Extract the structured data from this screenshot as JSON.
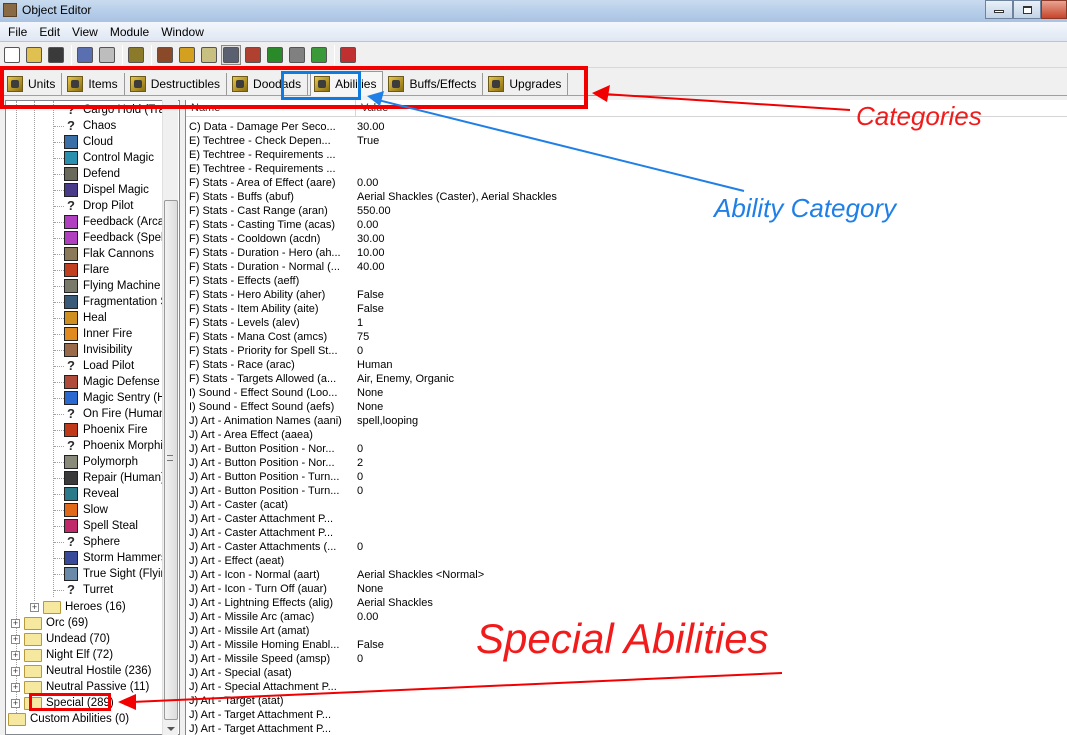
{
  "window": {
    "title": "Object Editor",
    "controls": [
      "minimize",
      "maximize",
      "close"
    ]
  },
  "menu": [
    "File",
    "Edit",
    "View",
    "Module",
    "Window"
  ],
  "toolbar": [
    {
      "icon": "new-file-icon",
      "color": "#ffffff"
    },
    {
      "icon": "open-folder-icon",
      "color": "#e0c050"
    },
    {
      "icon": "save-disk-icon",
      "color": "#3a3a3a"
    },
    {
      "sep": true
    },
    {
      "icon": "copy-icon",
      "color": "#5a6fb0"
    },
    {
      "icon": "paste-disabled-icon",
      "color": "#bdbdbd"
    },
    {
      "sep": true
    },
    {
      "icon": "abilities-fist-icon",
      "color": "#8a7a2a"
    },
    {
      "sep": true
    },
    {
      "icon": "terrain-editor-icon",
      "color": "#8a4a2a"
    },
    {
      "icon": "trigger-editor-icon",
      "color": "#d4a020"
    },
    {
      "icon": "sound-editor-icon",
      "color": "#c8c080"
    },
    {
      "icon": "object-editor-icon",
      "color": "#5a6070",
      "pressed": true
    },
    {
      "icon": "campaign-editor-icon",
      "color": "#b04030"
    },
    {
      "icon": "ai-editor-icon",
      "color": "#2a8a2a"
    },
    {
      "icon": "import-manager-icon",
      "color": "#808080"
    },
    {
      "icon": "object-manager-icon",
      "color": "#3a9a3a"
    },
    {
      "sep": true
    },
    {
      "icon": "test-map-icon",
      "color": "#c03030"
    }
  ],
  "tabs": [
    {
      "label": "Units",
      "icon": "units-helmet-icon",
      "active": false
    },
    {
      "label": "Items",
      "icon": "items-chest-icon",
      "active": false
    },
    {
      "label": "Destructibles",
      "icon": "destructibles-tree-icon",
      "active": false
    },
    {
      "label": "Doodads",
      "icon": "doodads-tower-icon",
      "active": false
    },
    {
      "label": "Abilities",
      "icon": "abilities-fist-icon",
      "active": true
    },
    {
      "label": "Buffs/Effects",
      "icon": "buffs-fist-icon",
      "active": false
    },
    {
      "label": "Upgrades",
      "icon": "upgrades-shield-icon",
      "active": false
    }
  ],
  "tree": {
    "partial_top_item": "Cargo Hold (Tra",
    "abilities": [
      {
        "label": "Chaos",
        "icon": "unknown-ability-icon",
        "color": "#333"
      },
      {
        "label": "Cloud",
        "icon": "cloud-icon",
        "color": "#3a6fa8"
      },
      {
        "label": "Control Magic",
        "icon": "control-magic-icon",
        "color": "#2a90b0"
      },
      {
        "label": "Defend",
        "icon": "defend-icon",
        "color": "#6a6a5a"
      },
      {
        "label": "Dispel Magic",
        "icon": "dispel-magic-icon",
        "color": "#4a3a8a"
      },
      {
        "label": "Drop Pilot",
        "icon": "unknown-ability-icon",
        "color": "#333"
      },
      {
        "label": "Feedback (Arca",
        "icon": "feedback-icon",
        "color": "#b040c0"
      },
      {
        "label": "Feedback (Spell",
        "icon": "feedback-icon",
        "color": "#b040c0"
      },
      {
        "label": "Flak Cannons",
        "icon": "flak-cannons-icon",
        "color": "#8a7a5a"
      },
      {
        "label": "Flare",
        "icon": "flare-icon",
        "color": "#c04020"
      },
      {
        "label": "Flying Machine I",
        "icon": "flying-machine-icon",
        "color": "#7a7a6a"
      },
      {
        "label": "Fragmentation S",
        "icon": "fragmentation-icon",
        "color": "#3a5a7a"
      },
      {
        "label": "Heal",
        "icon": "heal-icon",
        "color": "#d09020"
      },
      {
        "label": "Inner Fire",
        "icon": "inner-fire-icon",
        "color": "#e08a20"
      },
      {
        "label": "Invisibility",
        "icon": "invisibility-icon",
        "color": "#9a6a4a"
      },
      {
        "label": "Load Pilot",
        "icon": "unknown-ability-icon",
        "color": "#333"
      },
      {
        "label": "Magic Defense",
        "icon": "magic-defense-icon",
        "color": "#b04a3a"
      },
      {
        "label": "Magic Sentry (H",
        "icon": "magic-sentry-icon",
        "color": "#2a6ad0"
      },
      {
        "label": "On Fire (Human)",
        "icon": "unknown-ability-icon",
        "color": "#333"
      },
      {
        "label": "Phoenix Fire",
        "icon": "phoenix-fire-icon",
        "color": "#c03a1a"
      },
      {
        "label": "Phoenix Morphir",
        "icon": "unknown-ability-icon",
        "color": "#333"
      },
      {
        "label": "Polymorph",
        "icon": "polymorph-icon",
        "color": "#8a8a7a"
      },
      {
        "label": "Repair (Human)",
        "icon": "repair-icon",
        "color": "#3a3a3a"
      },
      {
        "label": "Reveal",
        "icon": "reveal-icon",
        "color": "#2a7a8a"
      },
      {
        "label": "Slow",
        "icon": "slow-icon",
        "color": "#e06a1a"
      },
      {
        "label": "Spell Steal",
        "icon": "spell-steal-icon",
        "color": "#c02a6a"
      },
      {
        "label": "Sphere",
        "icon": "unknown-ability-icon",
        "color": "#333"
      },
      {
        "label": "Storm Hammers",
        "icon": "storm-hammers-icon",
        "color": "#3a4a9a"
      },
      {
        "label": "True Sight (Flyin",
        "icon": "true-sight-icon",
        "color": "#6a8aaa"
      },
      {
        "label": "Turret",
        "icon": "unknown-ability-icon",
        "color": "#333"
      }
    ],
    "subfolder": {
      "label": "Heroes (16)"
    },
    "race_folders": [
      {
        "label": "Orc (69)"
      },
      {
        "label": "Undead (70)"
      },
      {
        "label": "Night Elf (72)"
      },
      {
        "label": "Neutral Hostile (236)"
      },
      {
        "label": "Neutral Passive (11)"
      },
      {
        "label": "Special (289)"
      }
    ],
    "root_folder": {
      "label": "Custom Abilities (0)"
    }
  },
  "properties": {
    "columns": {
      "name": "Name",
      "value": "Value"
    },
    "rows": [
      {
        "name": "C) Data - Damage Per Seco...",
        "value": "30.00"
      },
      {
        "name": "E) Techtree - Check Depen...",
        "value": "True"
      },
      {
        "name": "E) Techtree - Requirements ...",
        "value": ""
      },
      {
        "name": "E) Techtree - Requirements ...",
        "value": ""
      },
      {
        "name": "F) Stats - Area of Effect (aare)",
        "value": "0.00"
      },
      {
        "name": "F) Stats - Buffs (abuf)",
        "value": "Aerial Shackles (Caster), Aerial Shackles"
      },
      {
        "name": "F) Stats - Cast Range (aran)",
        "value": "550.00"
      },
      {
        "name": "F) Stats - Casting Time (acas)",
        "value": "0.00"
      },
      {
        "name": "F) Stats - Cooldown (acdn)",
        "value": "30.00"
      },
      {
        "name": "F) Stats - Duration - Hero (ah...",
        "value": "10.00"
      },
      {
        "name": "F) Stats - Duration - Normal (...",
        "value": "40.00"
      },
      {
        "name": "F) Stats - Effects (aeff)",
        "value": ""
      },
      {
        "name": "F) Stats - Hero Ability (aher)",
        "value": "False"
      },
      {
        "name": "F) Stats - Item Ability (aite)",
        "value": "False"
      },
      {
        "name": "F) Stats - Levels (alev)",
        "value": "1"
      },
      {
        "name": "F) Stats - Mana Cost (amcs)",
        "value": "75"
      },
      {
        "name": "F) Stats - Priority for Spell St...",
        "value": "0"
      },
      {
        "name": "F) Stats - Race (arac)",
        "value": "Human"
      },
      {
        "name": "F) Stats - Targets Allowed (a...",
        "value": "Air, Enemy, Organic"
      },
      {
        "name": "I) Sound - Effect Sound (Loo...",
        "value": "None"
      },
      {
        "name": "I) Sound - Effect Sound (aefs)",
        "value": "None"
      },
      {
        "name": "J) Art - Animation Names (aani)",
        "value": "spell,looping"
      },
      {
        "name": "J) Art - Area Effect (aaea)",
        "value": ""
      },
      {
        "name": "J) Art - Button Position - Nor...",
        "value": "0"
      },
      {
        "name": "J) Art - Button Position - Nor...",
        "value": "2"
      },
      {
        "name": "J) Art - Button Position - Turn...",
        "value": "0"
      },
      {
        "name": "J) Art - Button Position - Turn...",
        "value": "0"
      },
      {
        "name": "J) Art - Caster (acat)",
        "value": ""
      },
      {
        "name": "J) Art - Caster Attachment P...",
        "value": ""
      },
      {
        "name": "J) Art - Caster Attachment P...",
        "value": ""
      },
      {
        "name": "J) Art - Caster Attachments (...",
        "value": "0"
      },
      {
        "name": "J) Art - Effect (aeat)",
        "value": ""
      },
      {
        "name": "J) Art - Icon - Normal (aart)",
        "value": "Aerial Shackles <Normal>"
      },
      {
        "name": "J) Art - Icon - Turn Off (auar)",
        "value": "None"
      },
      {
        "name": "J) Art - Lightning Effects (alig)",
        "value": "Aerial Shackles"
      },
      {
        "name": "J) Art - Missile Arc (amac)",
        "value": "0.00"
      },
      {
        "name": "J) Art - Missile Art (amat)",
        "value": ""
      },
      {
        "name": "J) Art - Missile Homing Enabl...",
        "value": "False"
      },
      {
        "name": "J) Art - Missile Speed (amsp)",
        "value": "0"
      },
      {
        "name": "J) Art - Special (asat)",
        "value": ""
      },
      {
        "name": "J) Art - Special Attachment P...",
        "value": ""
      },
      {
        "name": "J) Art - Target (atat)",
        "value": ""
      },
      {
        "name": "J) Art - Target Attachment P...",
        "value": ""
      },
      {
        "name": "J) Art - Target Attachment P...",
        "value": ""
      }
    ]
  },
  "annotations": {
    "categories": "Categories",
    "ability_category": "Ability Category",
    "special_abilities": "Special Abilities",
    "red": "#f20000",
    "blue": "#0f7be0"
  }
}
